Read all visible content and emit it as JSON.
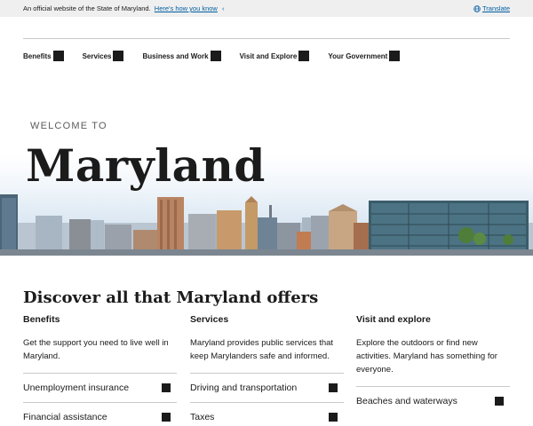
{
  "gov_banner": {
    "official_text": "An official website of the State of Maryland.",
    "how_link": "Here's how you know",
    "translate": "Translate"
  },
  "nav": {
    "items": [
      {
        "label": "Benefits"
      },
      {
        "label": "Services"
      },
      {
        "label": "Business and Work"
      },
      {
        "label": "Visit and Explore"
      },
      {
        "label": "Your Government"
      }
    ]
  },
  "hero": {
    "kicker": "WELCOME TO",
    "title": "Maryland"
  },
  "discover": {
    "heading": "Discover all that Maryland offers",
    "columns": [
      {
        "title": "Benefits",
        "description": "Get the support you need to live well in Maryland.",
        "links": [
          "Unemployment insurance",
          "Financial assistance"
        ]
      },
      {
        "title": "Services",
        "description": "Maryland provides public services that keep Marylanders safe and informed.",
        "links": [
          "Driving and transportation",
          "Taxes"
        ]
      },
      {
        "title": "Visit and explore",
        "description": "Explore the outdoors or find new activities. Maryland has something for everyone.",
        "links": [
          "Beaches and waterways"
        ]
      }
    ]
  },
  "colors": {
    "link_blue": "#005ea2",
    "banner_bg": "#efefef",
    "text": "#1b1b1b",
    "rule": "#c9c9c9"
  }
}
